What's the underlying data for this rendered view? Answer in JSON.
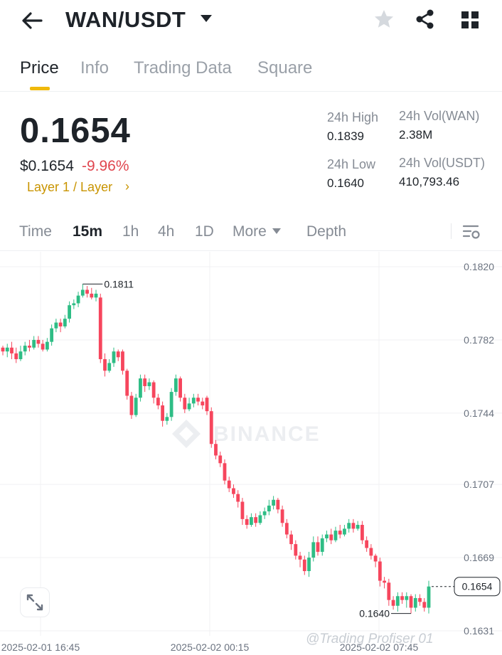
{
  "header": {
    "pair": "WAN/USDT",
    "icons": {
      "back": "back-arrow-icon",
      "caret": "caret-down-icon",
      "favorite": "star-icon",
      "share": "share-icon",
      "grid": "grid-icon"
    }
  },
  "tabs": [
    {
      "label": "Price",
      "active": true
    },
    {
      "label": "Info",
      "active": false
    },
    {
      "label": "Trading Data",
      "active": false
    },
    {
      "label": "Square",
      "active": false
    }
  ],
  "price": {
    "last": "0.1654",
    "usd": "$0.1654",
    "change": "-9.96%",
    "category": "Layer 1 / Layer",
    "category_chevron": "›"
  },
  "stats": {
    "high_label": "24h High",
    "high_value": "0.1839",
    "low_label": "24h Low",
    "low_value": "0.1640",
    "vol_base_label": "24h Vol(WAN)",
    "vol_base_value": "2.38M",
    "vol_quote_label": "24h Vol(USDT)",
    "vol_quote_value": "410,793.46"
  },
  "intervals": {
    "items": [
      {
        "label": "Time",
        "active": false
      },
      {
        "label": "15m",
        "active": true
      },
      {
        "label": "1h",
        "active": false
      },
      {
        "label": "4h",
        "active": false
      },
      {
        "label": "1D",
        "active": false
      },
      {
        "label": "More",
        "active": false
      },
      {
        "label": "Depth",
        "active": false
      }
    ]
  },
  "colors": {
    "up": "#2ebd85",
    "down": "#f6465d",
    "accent": "#f0b90b"
  },
  "chart_data": {
    "type": "candlestick",
    "y_ticks": [
      "0.1820",
      "0.1782",
      "0.1744",
      "0.1707",
      "0.1669",
      "0.1631"
    ],
    "ylim": [
      0.1631,
      0.182
    ],
    "x_ticks": [
      "2025-02-01 16:45",
      "2025-02-02 00:15",
      "2025-02-02 07:45"
    ],
    "high_marker": "0.1811",
    "low_marker": "0.1640",
    "current_price": "0.1654",
    "watermark": "BINANCE",
    "candles": [
      [
        0.1778,
        0.1776,
        0.1779,
        0.1774
      ],
      [
        0.1776,
        0.1778,
        0.178,
        0.1773
      ],
      [
        0.1778,
        0.1775,
        0.1781,
        0.1772
      ],
      [
        0.1775,
        0.1772,
        0.1778,
        0.177
      ],
      [
        0.1772,
        0.1776,
        0.1779,
        0.1771
      ],
      [
        0.1776,
        0.1779,
        0.1781,
        0.1774
      ],
      [
        0.1779,
        0.1778,
        0.1782,
        0.1776
      ],
      [
        0.1778,
        0.1782,
        0.1784,
        0.1777
      ],
      [
        0.1782,
        0.178,
        0.1784,
        0.1778
      ],
      [
        0.178,
        0.1777,
        0.1782,
        0.1776
      ],
      [
        0.1777,
        0.1781,
        0.1783,
        0.1776
      ],
      [
        0.1781,
        0.1788,
        0.179,
        0.1779
      ],
      [
        0.1788,
        0.1791,
        0.1793,
        0.1786
      ],
      [
        0.1791,
        0.1789,
        0.1793,
        0.1786
      ],
      [
        0.1789,
        0.1793,
        0.1795,
        0.1788
      ],
      [
        0.1793,
        0.18,
        0.1802,
        0.1791
      ],
      [
        0.18,
        0.1801,
        0.1803,
        0.1798
      ],
      [
        0.1801,
        0.1805,
        0.1807,
        0.1799
      ],
      [
        0.1805,
        0.1808,
        0.1811,
        0.1804
      ],
      [
        0.1808,
        0.1806,
        0.181,
        0.1804
      ],
      [
        0.1806,
        0.1804,
        0.1809,
        0.1803
      ],
      [
        0.1804,
        0.1806,
        0.1808,
        0.1802
      ],
      [
        0.1804,
        0.1772,
        0.1806,
        0.177
      ],
      [
        0.1772,
        0.1766,
        0.1775,
        0.1763
      ],
      [
        0.1766,
        0.177,
        0.1772,
        0.1765
      ],
      [
        0.177,
        0.1776,
        0.1778,
        0.1768
      ],
      [
        0.1776,
        0.1773,
        0.1777,
        0.1771
      ],
      [
        0.1776,
        0.1766,
        0.1777,
        0.1764
      ],
      [
        0.1766,
        0.1753,
        0.1767,
        0.1751
      ],
      [
        0.1753,
        0.1743,
        0.1755,
        0.1741
      ],
      [
        0.1743,
        0.1752,
        0.1754,
        0.1742
      ],
      [
        0.1752,
        0.1762,
        0.1764,
        0.175
      ],
      [
        0.1762,
        0.1758,
        0.1764,
        0.1755
      ],
      [
        0.1758,
        0.176,
        0.1762,
        0.1756
      ],
      [
        0.176,
        0.1752,
        0.1761,
        0.1749
      ],
      [
        0.1752,
        0.1748,
        0.1754,
        0.1746
      ],
      [
        0.1748,
        0.174,
        0.175,
        0.1737
      ],
      [
        0.174,
        0.1742,
        0.1744,
        0.1738
      ],
      [
        0.1742,
        0.1755,
        0.1757,
        0.174
      ],
      [
        0.1755,
        0.1762,
        0.1764,
        0.1753
      ],
      [
        0.1762,
        0.1752,
        0.1763,
        0.175
      ],
      [
        0.1752,
        0.1746,
        0.1754,
        0.1744
      ],
      [
        0.1746,
        0.1749,
        0.1752,
        0.1745
      ],
      [
        0.1749,
        0.1752,
        0.1754,
        0.1747
      ],
      [
        0.1752,
        0.175,
        0.1754,
        0.1748
      ],
      [
        0.175,
        0.1748,
        0.1752,
        0.1746
      ],
      [
        0.1752,
        0.1745,
        0.1753,
        0.1743
      ],
      [
        0.1745,
        0.1728,
        0.1747,
        0.1726
      ],
      [
        0.1728,
        0.1722,
        0.173,
        0.172
      ],
      [
        0.1722,
        0.1718,
        0.1724,
        0.1716
      ],
      [
        0.1718,
        0.1709,
        0.172,
        0.1707
      ],
      [
        0.1709,
        0.1705,
        0.1711,
        0.1703
      ],
      [
        0.1705,
        0.1702,
        0.1707,
        0.17
      ],
      [
        0.1702,
        0.1698,
        0.1704,
        0.1695
      ],
      [
        0.1698,
        0.1689,
        0.17,
        0.1686
      ],
      [
        0.1689,
        0.1686,
        0.1691,
        0.1684
      ],
      [
        0.1686,
        0.169,
        0.1692,
        0.1685
      ],
      [
        0.169,
        0.1687,
        0.1692,
        0.1685
      ],
      [
        0.1687,
        0.1691,
        0.1693,
        0.1686
      ],
      [
        0.1691,
        0.1693,
        0.1695,
        0.1689
      ],
      [
        0.1693,
        0.1696,
        0.1699,
        0.1691
      ],
      [
        0.1696,
        0.1699,
        0.1701,
        0.1694
      ],
      [
        0.1699,
        0.1694,
        0.17,
        0.1692
      ],
      [
        0.1694,
        0.1687,
        0.1696,
        0.1685
      ],
      [
        0.1687,
        0.1681,
        0.1689,
        0.1679
      ],
      [
        0.1681,
        0.1676,
        0.1683,
        0.1673
      ],
      [
        0.1676,
        0.167,
        0.1678,
        0.1668
      ],
      [
        0.167,
        0.1668,
        0.1672,
        0.1664
      ],
      [
        0.1668,
        0.1662,
        0.167,
        0.166
      ],
      [
        0.1662,
        0.1669,
        0.1672,
        0.1659
      ],
      [
        0.1669,
        0.1677,
        0.168,
        0.1667
      ],
      [
        0.1677,
        0.1672,
        0.168,
        0.167
      ],
      [
        0.1672,
        0.1679,
        0.1681,
        0.167
      ],
      [
        0.1679,
        0.1681,
        0.1683,
        0.1677
      ],
      [
        0.1681,
        0.1678,
        0.1684,
        0.1676
      ],
      [
        0.1678,
        0.1683,
        0.1685,
        0.1677
      ],
      [
        0.1683,
        0.1681,
        0.1686,
        0.1679
      ],
      [
        0.1681,
        0.1684,
        0.1686,
        0.168
      ],
      [
        0.1684,
        0.1687,
        0.1689,
        0.1682
      ],
      [
        0.1687,
        0.1684,
        0.1689,
        0.1682
      ],
      [
        0.1684,
        0.1686,
        0.1688,
        0.1683
      ],
      [
        0.1686,
        0.1678,
        0.1688,
        0.1676
      ],
      [
        0.1678,
        0.1674,
        0.168,
        0.1672
      ],
      [
        0.1674,
        0.167,
        0.1676,
        0.1668
      ],
      [
        0.167,
        0.1667,
        0.1671,
        0.1664
      ],
      [
        0.1667,
        0.1657,
        0.1669,
        0.1654
      ],
      [
        0.1657,
        0.1656,
        0.1659,
        0.1653
      ],
      [
        0.1656,
        0.1647,
        0.1658,
        0.1644
      ],
      [
        0.1647,
        0.1644,
        0.1649,
        0.1642
      ],
      [
        0.1644,
        0.1649,
        0.1651,
        0.1641
      ],
      [
        0.1649,
        0.1647,
        0.1651,
        0.1645
      ],
      [
        0.1647,
        0.1649,
        0.1651,
        0.1643
      ],
      [
        0.1649,
        0.1643,
        0.165,
        0.164
      ],
      [
        0.1643,
        0.1648,
        0.165,
        0.1641
      ],
      [
        0.1648,
        0.1646,
        0.165,
        0.1644
      ],
      [
        0.1646,
        0.1643,
        0.1648,
        0.1641
      ],
      [
        0.1643,
        0.1654,
        0.1657,
        0.164
      ]
    ]
  },
  "footer": {
    "credit": "@Trading Profiser 01"
  }
}
